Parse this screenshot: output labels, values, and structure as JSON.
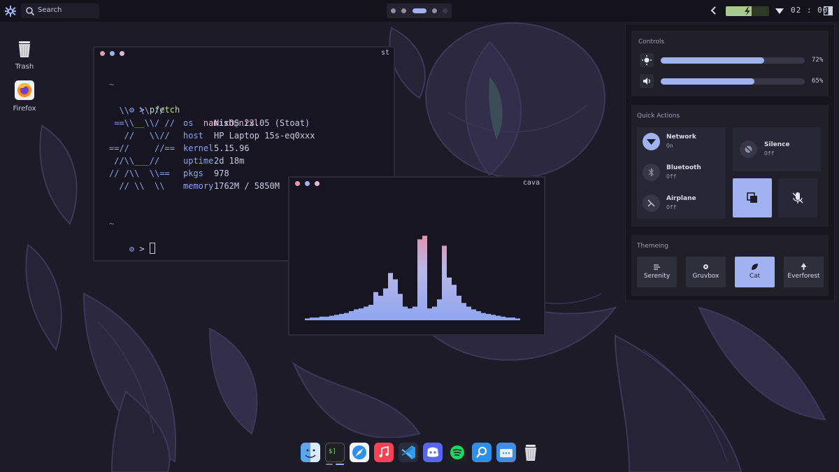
{
  "topbar": {
    "search_label": "Search",
    "workspaces": [
      {
        "active": false
      },
      {
        "active": false
      },
      {
        "active": true
      },
      {
        "active": false
      },
      {
        "active": false
      }
    ],
    "battery_level": 0.6,
    "clock": "02 : 00"
  },
  "desktop_icons": [
    {
      "label": "Trash",
      "icon": "trash-icon"
    },
    {
      "label": "Firefox",
      "icon": "firefox-icon"
    }
  ],
  "terminal": {
    "title": "st",
    "tilde": "~",
    "prompt_arrow": ">",
    "command": "pfetch",
    "logo_lines": [
      "  \\\\  \\\\ //",
      " ==\\\\__\\\\/ //",
      "   //   \\\\//",
      "==//     //==",
      " //\\\\___//",
      "// /\\\\  \\\\==",
      "  // \\\\  \\\\"
    ],
    "user": "namish",
    "at": "@",
    "host": "nixl",
    "info": [
      {
        "key": "os",
        "value": "NixOS 23.05 (Stoat)"
      },
      {
        "key": "host",
        "value": "HP Laptop 15s-eq0xxx"
      },
      {
        "key": "kernel",
        "value": "5.15.96"
      },
      {
        "key": "uptime",
        "value": "2d 18m"
      },
      {
        "key": "pkgs",
        "value": "978"
      },
      {
        "key": "memory",
        "value": "1762M / 5850M"
      }
    ]
  },
  "cava": {
    "title": "cava",
    "bars": [
      0.02,
      0.03,
      0.03,
      0.04,
      0.04,
      0.05,
      0.06,
      0.07,
      0.08,
      0.1,
      0.12,
      0.13,
      0.15,
      0.17,
      0.31,
      0.27,
      0.35,
      0.52,
      0.45,
      0.29,
      0.15,
      0.13,
      0.15,
      0.89,
      0.93,
      0.13,
      0.15,
      0.23,
      0.82,
      0.47,
      0.39,
      0.27,
      0.19,
      0.15,
      0.12,
      0.1,
      0.08,
      0.07,
      0.06,
      0.05,
      0.04,
      0.03,
      0.03,
      0.02
    ]
  },
  "panel": {
    "controls_title": "Controls",
    "brightness": {
      "value": 0.72,
      "label": "72%"
    },
    "volume": {
      "value": 0.65,
      "label": "65%"
    },
    "quick_actions_title": "Quick Actions",
    "network": {
      "name": "Network",
      "state": "On"
    },
    "bluetooth": {
      "name": "Bluetooth",
      "state": "Off"
    },
    "airplane": {
      "name": "Airplane",
      "state": "Off"
    },
    "silence": {
      "name": "Silence",
      "state": "Off"
    },
    "theming_title": "Themeing",
    "themes": [
      "Serenity",
      "Gruvbox",
      "Cat",
      "Everforest"
    ],
    "active_theme": "Cat"
  },
  "dock": {
    "apps": [
      "finder-icon",
      "terminal-icon",
      "safari-icon",
      "music-icon",
      "vscode-icon",
      "discord-icon",
      "spotify-icon",
      "search-app-icon",
      "file-manager-icon",
      "trash-icon"
    ]
  },
  "colors": {
    "accent": "#a0b2f0",
    "pink": "#e5b6cf",
    "green": "#b7e08f",
    "bg": "#161521"
  }
}
